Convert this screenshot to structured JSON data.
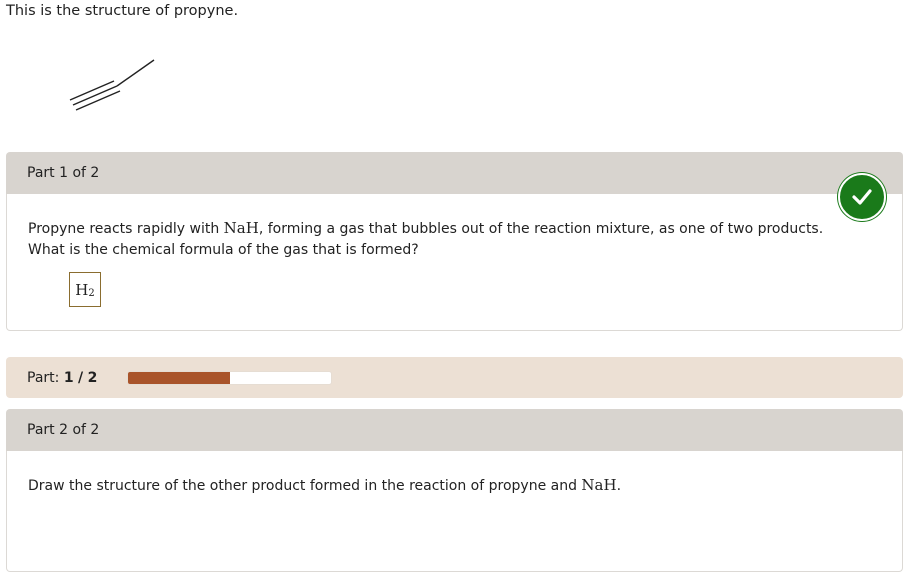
{
  "intro_text": "This is the structure of propyne.",
  "part1": {
    "header": "Part 1 of 2",
    "question_line1_a": "Propyne reacts rapidly with ",
    "question_line1_reagent": "NaH",
    "question_line1_b": ", forming a gas that bubbles out of the reaction mixture, as one of two products.",
    "question_line2": "What is the chemical formula of the gas that is formed?",
    "answer_symbol": "H",
    "answer_subscript": "2",
    "status": "correct"
  },
  "progress": {
    "label": "Part:",
    "current": "1",
    "separator": "/",
    "total": "2",
    "fraction": 0.5,
    "color": "#a9542a"
  },
  "part2": {
    "header": "Part 2 of 2",
    "question_a": "Draw the structure of the other product formed in the reaction of propyne and ",
    "question_reagent": "NaH",
    "question_b": "."
  },
  "icons": {
    "status": "checkmark-icon"
  },
  "colors": {
    "success": "#1a7a1a",
    "panel_header": "#d8d4cf",
    "progress_bg": "#ece0d4"
  }
}
